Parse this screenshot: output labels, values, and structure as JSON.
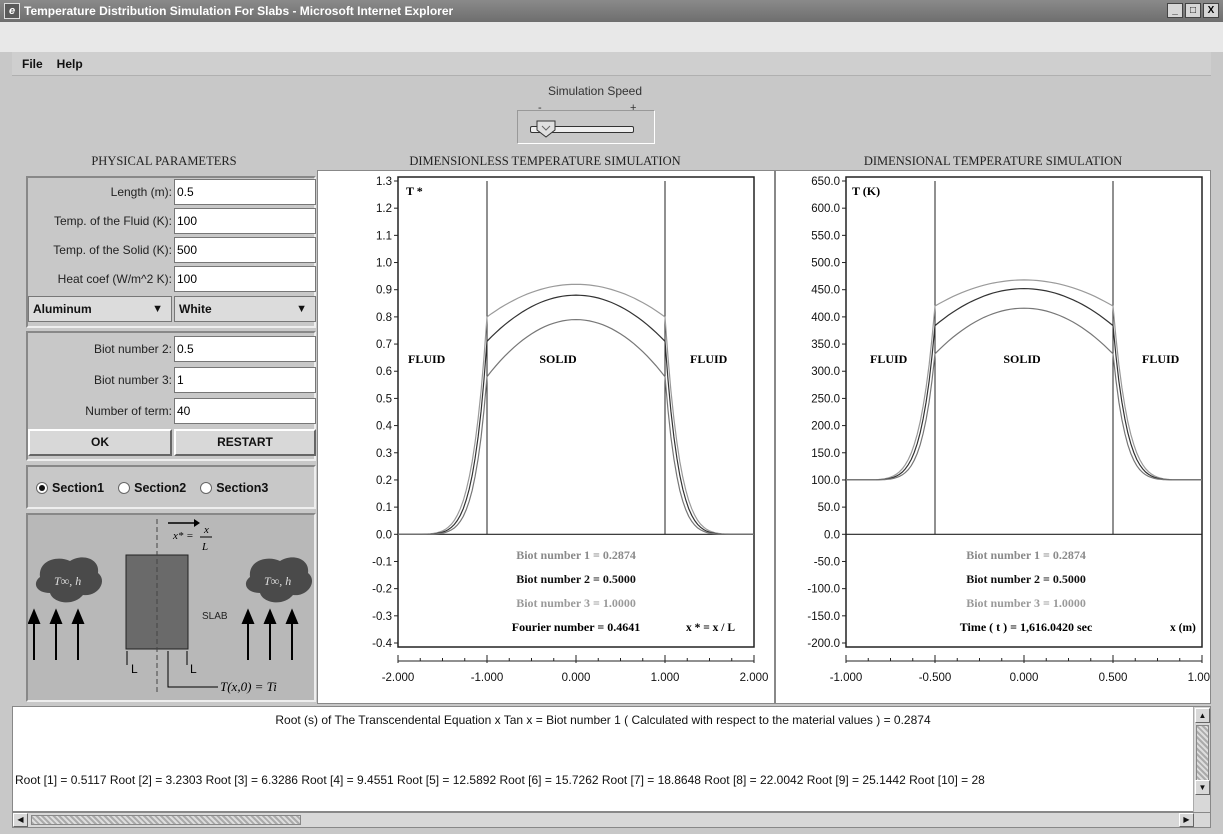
{
  "window": {
    "title": "Temperature Distribution Simulation For Slabs - Microsoft Internet Explorer",
    "minimize": "_",
    "maximize": "□",
    "close": "X"
  },
  "menu": {
    "file": "File",
    "help": "Help"
  },
  "speed": {
    "label": "Simulation Speed",
    "minus": "-",
    "plus": "+",
    "level": 0.1
  },
  "physical": {
    "title": "PHYSICAL PARAMETERS",
    "fields": [
      {
        "label": "Length (m):",
        "value": "0.5"
      },
      {
        "label": "Temp. of the Fluid (K):",
        "value": "100"
      },
      {
        "label": "Temp. of the Solid (K):",
        "value": "500"
      },
      {
        "label": "Heat coef (W/m^2 K):",
        "value": "100"
      }
    ],
    "material": "Aluminum",
    "color": "White",
    "biot_fields": [
      {
        "label": "Biot number 2:",
        "value": "0.5"
      },
      {
        "label": "Biot number 3:",
        "value": "1"
      },
      {
        "label": "Number of term:",
        "value": "40"
      }
    ],
    "ok": "OK",
    "restart": "RESTART",
    "sections": [
      "Section1",
      "Section2",
      "Section3"
    ],
    "selected_section": "Section1"
  },
  "diagram": {
    "slab": "SLAB",
    "L_left": "L",
    "L_right": "L",
    "fluid_label": "T∞, h",
    "xstar": "x* =",
    "x": "x",
    "L": "L",
    "initial": "T(x,0) = Ti"
  },
  "sim1": {
    "title": "DIMENSIONLESS TEMPERATURE SIMULATION",
    "axis_label": "T *",
    "fluid_left": "FLUID",
    "solid": "SOLID",
    "fluid_right": "FLUID",
    "biot1": "Biot number 1 = 0.2874",
    "biot2": "Biot number 2 = 0.5000",
    "biot3": "Biot number 3 = 1.0000",
    "status": "Fourier number = 0.4641",
    "xaxis": "x * = x / L"
  },
  "sim2": {
    "title": "DIMENSIONAL TEMPERATURE SIMULATION",
    "axis_label": "T (K)",
    "fluid_left": "FLUID",
    "solid": "SOLID",
    "fluid_right": "FLUID",
    "biot1": "Biot number 1 = 0.2874",
    "biot2": "Biot number 2 = 0.5000",
    "biot3": "Biot number 3 = 1.0000",
    "status": "Time ( t ) =  1,616.0420 sec",
    "xaxis": "x (m)"
  },
  "chart_data": [
    {
      "type": "line",
      "title": "DIMENSIONLESS TEMPERATURE SIMULATION",
      "ylabel": "T *",
      "xlabel": "x * = x / L",
      "ylim": [
        -0.4,
        1.3
      ],
      "xlim": [
        -2.0,
        2.0
      ],
      "yticks": [
        "1.3",
        "1.2",
        "1.1",
        "1.0",
        "0.9",
        "0.8",
        "0.7",
        "0.6",
        "0.5",
        "0.4",
        "0.3",
        "0.2",
        "0.1",
        "0.0",
        "-0.1",
        "-0.2",
        "-0.3",
        "-0.4"
      ],
      "xticks": [
        "-2.000",
        "-1.000",
        "0.000",
        "1.000",
        "2.000"
      ],
      "series": [
        {
          "peak": 0.92,
          "edge": 0.8
        },
        {
          "peak": 0.88,
          "edge": 0.71
        },
        {
          "peak": 0.79,
          "edge": 0.58
        }
      ]
    },
    {
      "type": "line",
      "title": "DIMENSIONAL TEMPERATURE SIMULATION",
      "ylabel": "T (K)",
      "xlabel": "x (m)",
      "ylim": [
        -200.0,
        650.0
      ],
      "xlim": [
        -1.0,
        1.0
      ],
      "yticks": [
        "650.0",
        "600.0",
        "550.0",
        "500.0",
        "450.0",
        "400.0",
        "350.0",
        "300.0",
        "250.0",
        "200.0",
        "150.0",
        "100.0",
        "50.0",
        "0.0",
        "-50.0",
        "-100.0",
        "-150.0",
        "-200.0"
      ],
      "xticks": [
        "-1.000",
        "-0.500",
        "0.000",
        "0.500",
        "1.000"
      ],
      "series": [
        {
          "peak": 468,
          "edge": 420
        },
        {
          "peak": 452,
          "edge": 384
        },
        {
          "peak": 416,
          "edge": 332
        }
      ]
    }
  ],
  "roots": {
    "line1": "Root (s) of The Transcendental  Equation  x Tan x  =  Biot number 1  ( Calculated with respect to the material values )  =  0.2874",
    "line2": "Root [1] = 0.5117  Root [2] = 3.2303  Root [3] = 6.3286  Root [4] = 9.4551  Root [5] = 12.5892  Root [6] = 15.7262  Root [7] = 18.8648  Root [8] = 22.0042  Root [9] = 25.1442  Root [10] = 28"
  },
  "colors": {
    "curve_light": "#9a9a9a",
    "curve_dark": "#333333",
    "curve_mid": "#777777"
  }
}
